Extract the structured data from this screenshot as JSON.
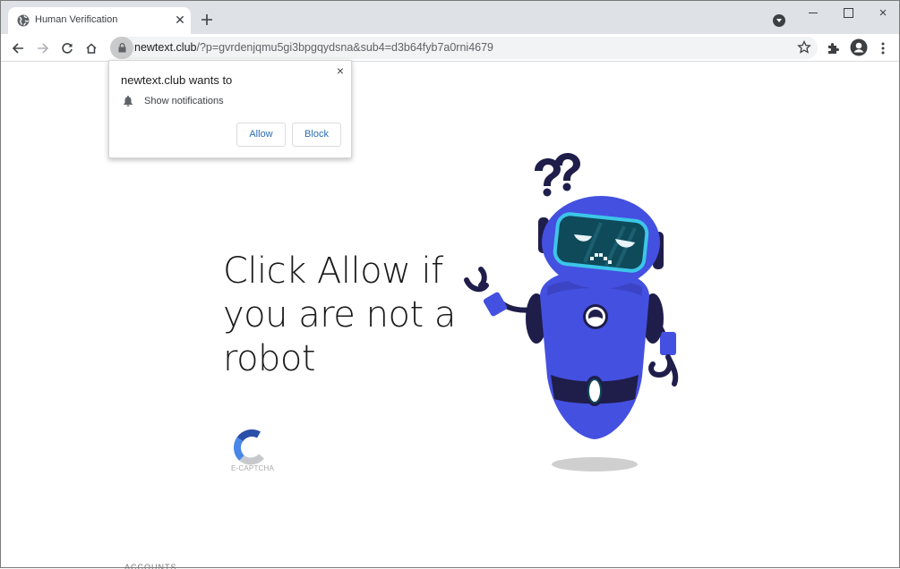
{
  "browser": {
    "tab": {
      "title": "Human Verification",
      "favicon": "globe-icon",
      "close_icon": "close-icon"
    },
    "new_tab_icon": "plus-icon",
    "window_controls": {
      "minimize": "minimize-icon",
      "maximize": "maximize-icon",
      "close": "×"
    },
    "toolbar": {
      "back_icon": "arrow-left-icon",
      "forward_icon": "arrow-right-icon",
      "reload_icon": "reload-icon",
      "home_icon": "home-icon",
      "lock_icon": "lock-icon",
      "url_host": "newtext.club",
      "url_path": "/?p=gvrdenjqmu5gi3bpgqydsna&sub4=d3b64fyb7a0rni4679",
      "bookmark_icon": "star-icon",
      "extensions_icon": "puzzle-icon",
      "profile_icon": "account-icon",
      "menu_icon": "more-vert-icon"
    }
  },
  "permission_popup": {
    "title": "newtext.club wants to",
    "permission": "Show notifications",
    "permission_icon": "bell-icon",
    "close": "×",
    "allow_label": "Allow",
    "block_label": "Block"
  },
  "page": {
    "headline": "Click Allow if you are not a robot",
    "captcha_label": "E-CAPTCHA",
    "illustration": "confused-robot",
    "bottom_cut_text": "ACCOUNTS"
  },
  "colors": {
    "robot_body": "#4450e0",
    "robot_dark": "#1f1d4a",
    "visor": "#0f4a5a",
    "visor_border": "#3cc6e8",
    "link_blue": "#2b6cb0"
  }
}
